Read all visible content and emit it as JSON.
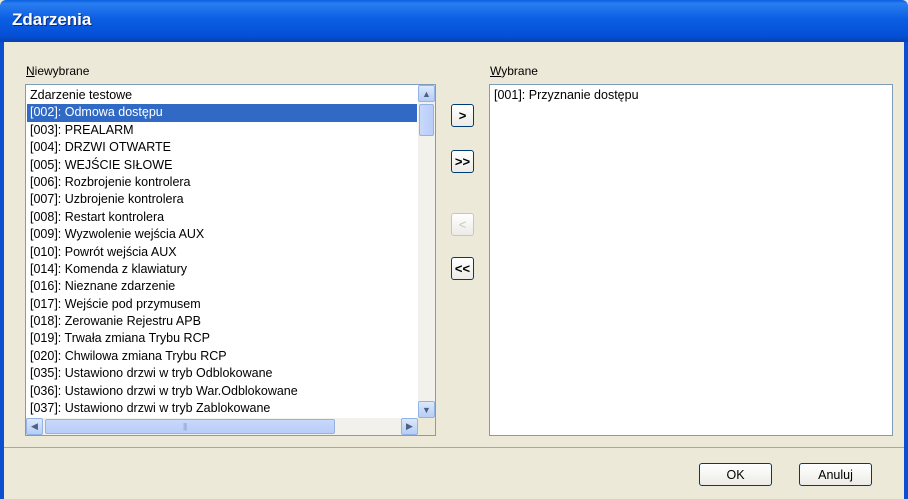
{
  "window": {
    "title": "Zdarzenia"
  },
  "left_panel": {
    "label_accel": "N",
    "label_rest": "iewybrane",
    "items": [
      "Zdarzenie testowe",
      "[002]: Odmowa dostępu",
      "[003]: PREALARM",
      "[004]: DRZWI OTWARTE",
      "[005]: WEJŚCIE SIŁOWE",
      "[006]: Rozbrojenie kontrolera",
      "[007]: Uzbrojenie kontrolera",
      "[008]: Restart kontrolera",
      "[009]: Wyzwolenie wejścia AUX",
      "[010]: Powrót wejścia AUX",
      "[014]: Komenda z klawiatury",
      "[016]: Nieznane zdarzenie",
      "[017]: Wejście pod przymusem",
      "[018]: Zerowanie Rejestru APB",
      "[019]: Trwała zmiana Trybu RCP",
      "[020]: Chwilowa zmiana Trybu RCP",
      "[035]: Ustawiono drzwi w tryb Odblokowane",
      "[036]: Ustawiono drzwi w tryb War.Odblokowane",
      "[037]: Ustawiono drzwi w tryb Zablokowane"
    ],
    "selected_index": 1
  },
  "right_panel": {
    "label_accel": "W",
    "label_rest": "ybrane",
    "items": [
      "[001]: Przyznanie dostępu"
    ]
  },
  "move_buttons": {
    "add_one": ">",
    "add_all": ">>",
    "remove_one": "<",
    "remove_all": "<<"
  },
  "footer": {
    "ok_label": "OK",
    "cancel_label": "Anuluj"
  }
}
